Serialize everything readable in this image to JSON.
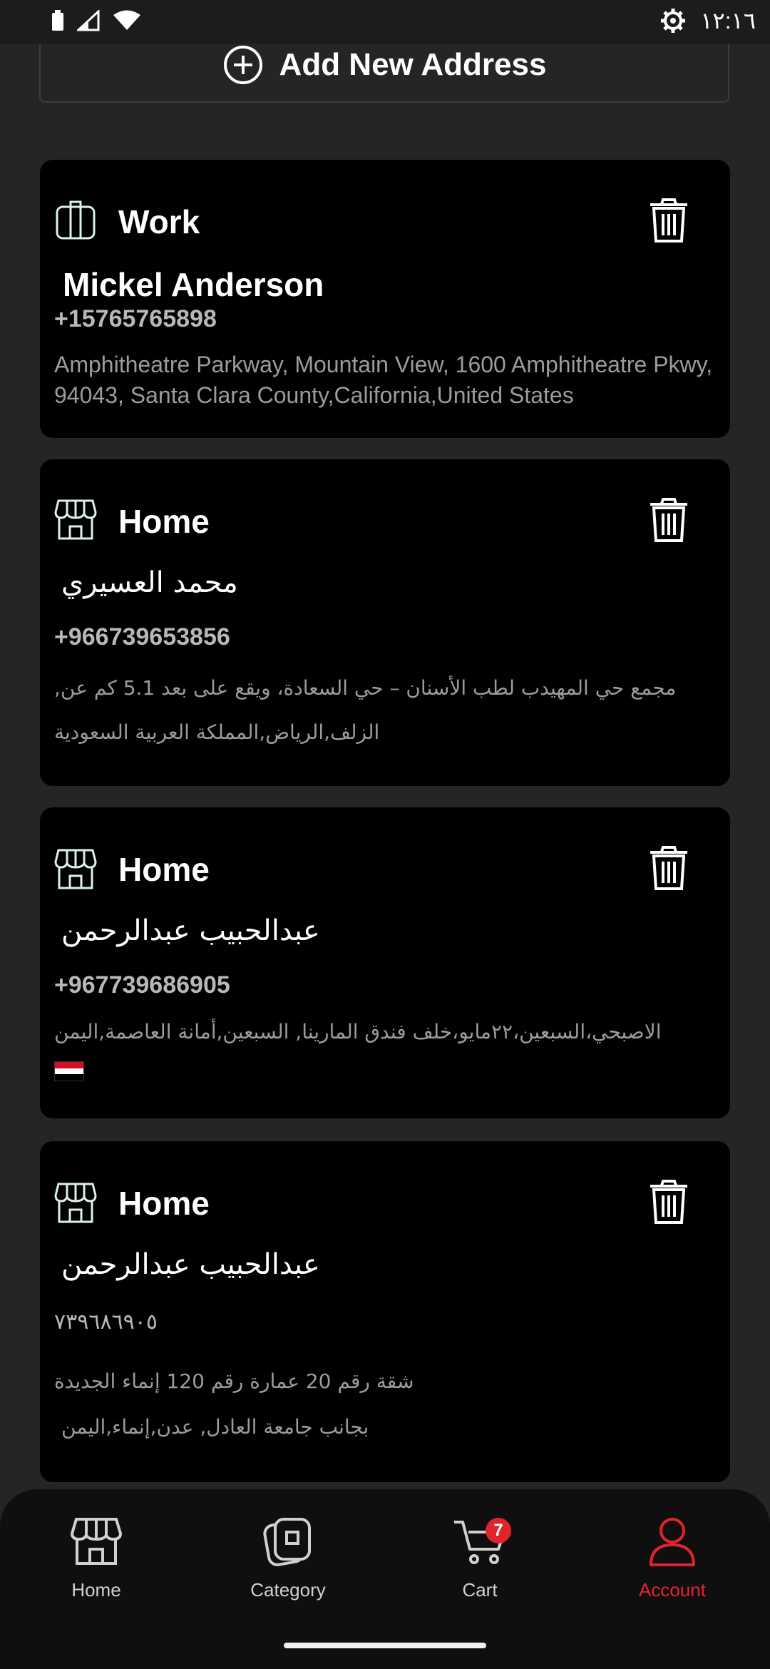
{
  "status_bar": {
    "time": "١٢:١٦"
  },
  "add_address": {
    "label": "Add New Address"
  },
  "addresses": [
    {
      "type": "Work",
      "name": "Mickel Anderson",
      "phone": "+15765765898",
      "address": "Amphitheatre Parkway, Mountain View, 1600 Amphitheatre Pkwy, 94043, Santa Clara County,California,United States"
    },
    {
      "type": "Home",
      "name": "محمد العسيري",
      "phone": "+966739653856",
      "address": "مجمع حي المهيدب لطب الأسنان – حي السعادة، ويقع على بعد 5.1 كم عن, الزلف,الرياض,المملكة العربية السعودية"
    },
    {
      "type": "Home",
      "name": "عبدالحبيب عبدالرحمن",
      "phone": "+967739686905",
      "address": "الاصبحي،السبعين،٢٢مايو،خلف فندق المارينا, السبعين,أمانة العاصمة,اليمن"
    },
    {
      "type": "Home",
      "name": "عبدالحبيب عبدالرحمن",
      "phone": "٧٣٩٦٨٦٩٠٥",
      "address_line1": "شقة رقم 20 عمارة رقم 120 إنماء الجديدة",
      "address_line2": "بجانب جامعة العادل, عدن,إنماء,اليمن"
    }
  ],
  "bottom_nav": {
    "home": "Home",
    "category": "Category",
    "cart": "Cart",
    "cart_badge": "7",
    "account": "Account"
  },
  "colors": {
    "background": "#252525",
    "card": "#000000",
    "accent_active": "#e0242c",
    "icon_mint": "#d8f3e8"
  }
}
